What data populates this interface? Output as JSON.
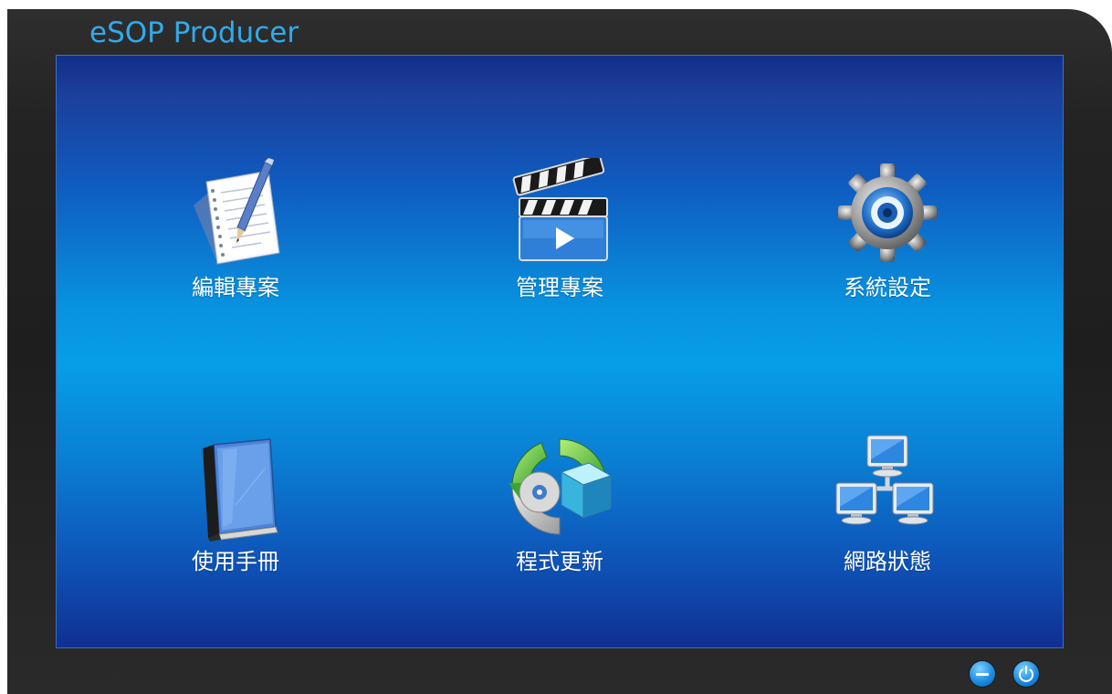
{
  "window": {
    "title": "eSOP Producer"
  },
  "menu": {
    "items": [
      {
        "label": "編輯專案",
        "icon": "edit-document-icon"
      },
      {
        "label": "管理專案",
        "icon": "clapperboard-icon"
      },
      {
        "label": "系統設定",
        "icon": "gear-icon"
      },
      {
        "label": "使用手冊",
        "icon": "manual-book-icon"
      },
      {
        "label": "程式更新",
        "icon": "update-icon"
      },
      {
        "label": "網路狀態",
        "icon": "network-icon"
      }
    ]
  },
  "controls": {
    "minimize": {
      "icon": "minimize-icon"
    },
    "power": {
      "icon": "power-icon"
    }
  },
  "colors": {
    "title": "#29a8ec",
    "panel_top": "#0c2a86",
    "panel_mid": "#079ee8",
    "frame": "#262626"
  }
}
